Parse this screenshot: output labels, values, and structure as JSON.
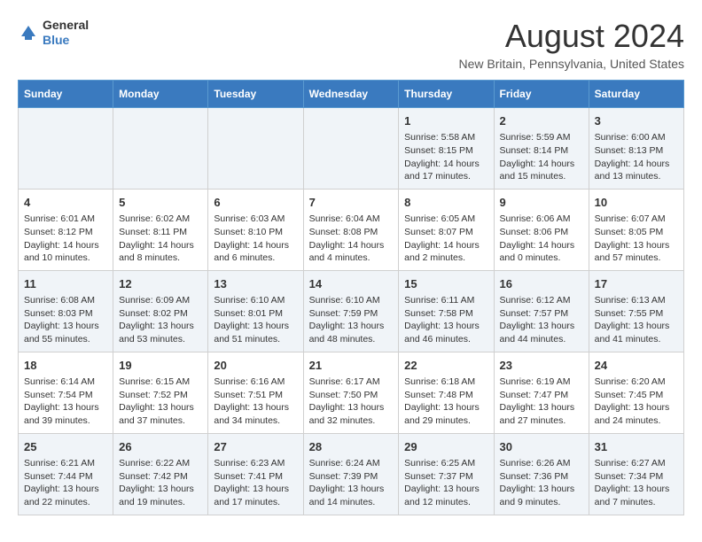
{
  "header": {
    "logo_line1": "General",
    "logo_line2": "Blue",
    "main_title": "August 2024",
    "subtitle": "New Britain, Pennsylvania, United States"
  },
  "calendar": {
    "days_of_week": [
      "Sunday",
      "Monday",
      "Tuesday",
      "Wednesday",
      "Thursday",
      "Friday",
      "Saturday"
    ],
    "weeks": [
      {
        "days": [
          {
            "num": "",
            "info": ""
          },
          {
            "num": "",
            "info": ""
          },
          {
            "num": "",
            "info": ""
          },
          {
            "num": "",
            "info": ""
          },
          {
            "num": "1",
            "info": "Sunrise: 5:58 AM\nSunset: 8:15 PM\nDaylight: 14 hours and 17 minutes."
          },
          {
            "num": "2",
            "info": "Sunrise: 5:59 AM\nSunset: 8:14 PM\nDaylight: 14 hours and 15 minutes."
          },
          {
            "num": "3",
            "info": "Sunrise: 6:00 AM\nSunset: 8:13 PM\nDaylight: 14 hours and 13 minutes."
          }
        ]
      },
      {
        "days": [
          {
            "num": "4",
            "info": "Sunrise: 6:01 AM\nSunset: 8:12 PM\nDaylight: 14 hours and 10 minutes."
          },
          {
            "num": "5",
            "info": "Sunrise: 6:02 AM\nSunset: 8:11 PM\nDaylight: 14 hours and 8 minutes."
          },
          {
            "num": "6",
            "info": "Sunrise: 6:03 AM\nSunset: 8:10 PM\nDaylight: 14 hours and 6 minutes."
          },
          {
            "num": "7",
            "info": "Sunrise: 6:04 AM\nSunset: 8:08 PM\nDaylight: 14 hours and 4 minutes."
          },
          {
            "num": "8",
            "info": "Sunrise: 6:05 AM\nSunset: 8:07 PM\nDaylight: 14 hours and 2 minutes."
          },
          {
            "num": "9",
            "info": "Sunrise: 6:06 AM\nSunset: 8:06 PM\nDaylight: 14 hours and 0 minutes."
          },
          {
            "num": "10",
            "info": "Sunrise: 6:07 AM\nSunset: 8:05 PM\nDaylight: 13 hours and 57 minutes."
          }
        ]
      },
      {
        "days": [
          {
            "num": "11",
            "info": "Sunrise: 6:08 AM\nSunset: 8:03 PM\nDaylight: 13 hours and 55 minutes."
          },
          {
            "num": "12",
            "info": "Sunrise: 6:09 AM\nSunset: 8:02 PM\nDaylight: 13 hours and 53 minutes."
          },
          {
            "num": "13",
            "info": "Sunrise: 6:10 AM\nSunset: 8:01 PM\nDaylight: 13 hours and 51 minutes."
          },
          {
            "num": "14",
            "info": "Sunrise: 6:10 AM\nSunset: 7:59 PM\nDaylight: 13 hours and 48 minutes."
          },
          {
            "num": "15",
            "info": "Sunrise: 6:11 AM\nSunset: 7:58 PM\nDaylight: 13 hours and 46 minutes."
          },
          {
            "num": "16",
            "info": "Sunrise: 6:12 AM\nSunset: 7:57 PM\nDaylight: 13 hours and 44 minutes."
          },
          {
            "num": "17",
            "info": "Sunrise: 6:13 AM\nSunset: 7:55 PM\nDaylight: 13 hours and 41 minutes."
          }
        ]
      },
      {
        "days": [
          {
            "num": "18",
            "info": "Sunrise: 6:14 AM\nSunset: 7:54 PM\nDaylight: 13 hours and 39 minutes."
          },
          {
            "num": "19",
            "info": "Sunrise: 6:15 AM\nSunset: 7:52 PM\nDaylight: 13 hours and 37 minutes."
          },
          {
            "num": "20",
            "info": "Sunrise: 6:16 AM\nSunset: 7:51 PM\nDaylight: 13 hours and 34 minutes."
          },
          {
            "num": "21",
            "info": "Sunrise: 6:17 AM\nSunset: 7:50 PM\nDaylight: 13 hours and 32 minutes."
          },
          {
            "num": "22",
            "info": "Sunrise: 6:18 AM\nSunset: 7:48 PM\nDaylight: 13 hours and 29 minutes."
          },
          {
            "num": "23",
            "info": "Sunrise: 6:19 AM\nSunset: 7:47 PM\nDaylight: 13 hours and 27 minutes."
          },
          {
            "num": "24",
            "info": "Sunrise: 6:20 AM\nSunset: 7:45 PM\nDaylight: 13 hours and 24 minutes."
          }
        ]
      },
      {
        "days": [
          {
            "num": "25",
            "info": "Sunrise: 6:21 AM\nSunset: 7:44 PM\nDaylight: 13 hours and 22 minutes."
          },
          {
            "num": "26",
            "info": "Sunrise: 6:22 AM\nSunset: 7:42 PM\nDaylight: 13 hours and 19 minutes."
          },
          {
            "num": "27",
            "info": "Sunrise: 6:23 AM\nSunset: 7:41 PM\nDaylight: 13 hours and 17 minutes."
          },
          {
            "num": "28",
            "info": "Sunrise: 6:24 AM\nSunset: 7:39 PM\nDaylight: 13 hours and 14 minutes."
          },
          {
            "num": "29",
            "info": "Sunrise: 6:25 AM\nSunset: 7:37 PM\nDaylight: 13 hours and 12 minutes."
          },
          {
            "num": "30",
            "info": "Sunrise: 6:26 AM\nSunset: 7:36 PM\nDaylight: 13 hours and 9 minutes."
          },
          {
            "num": "31",
            "info": "Sunrise: 6:27 AM\nSunset: 7:34 PM\nDaylight: 13 hours and 7 minutes."
          }
        ]
      }
    ]
  }
}
